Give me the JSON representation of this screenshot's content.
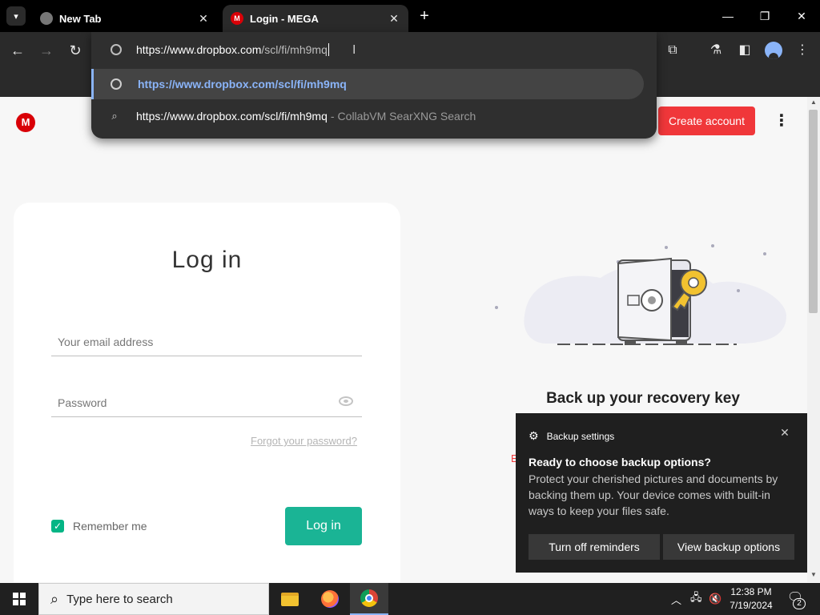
{
  "browser": {
    "tabs": [
      {
        "title": "New Tab",
        "favicon": "globe-icon"
      },
      {
        "title": "Login - MEGA",
        "favicon": "mega-icon",
        "favicon_letter": "M"
      }
    ],
    "new_tab_symbol": "+",
    "omnibox": {
      "input_host": "https://www.dropbox.com",
      "input_rest": "/scl/fi/mh9mq",
      "suggestions": [
        {
          "text": "https://www.dropbox.com/scl/fi/mh9mq",
          "icon": "globe-icon"
        },
        {
          "text": "https://www.dropbox.com/scl/fi/mh9mq",
          "separator": "-",
          "provider": "CollabVM SearXNG Search",
          "icon": "search-icon"
        }
      ]
    }
  },
  "page": {
    "logo_letter": "M",
    "create_account": "Create account",
    "login": {
      "title": "Log in",
      "email_placeholder": "Your email address",
      "password_placeholder": "Password",
      "forgot": "Forgot your password?",
      "remember_me": "Remember me",
      "submit": "Log in"
    },
    "recovery": {
      "title": "Back up your recovery key",
      "partial_link_letter": "E"
    }
  },
  "toast": {
    "app": "Backup settings",
    "title": "Ready to choose backup options?",
    "body": "Protect your cherished pictures and documents by backing them up. Your device comes with built-in ways to keep your files safe.",
    "button_off": "Turn off reminders",
    "button_view": "View backup options"
  },
  "taskbar": {
    "search_placeholder": "Type here to search",
    "time": "12:38 PM",
    "date": "7/19/2024",
    "notification_count": "2"
  },
  "colors": {
    "accent_red": "#f0373a",
    "accent_green": "#1ab495",
    "link_blue": "#8ab4f8"
  }
}
